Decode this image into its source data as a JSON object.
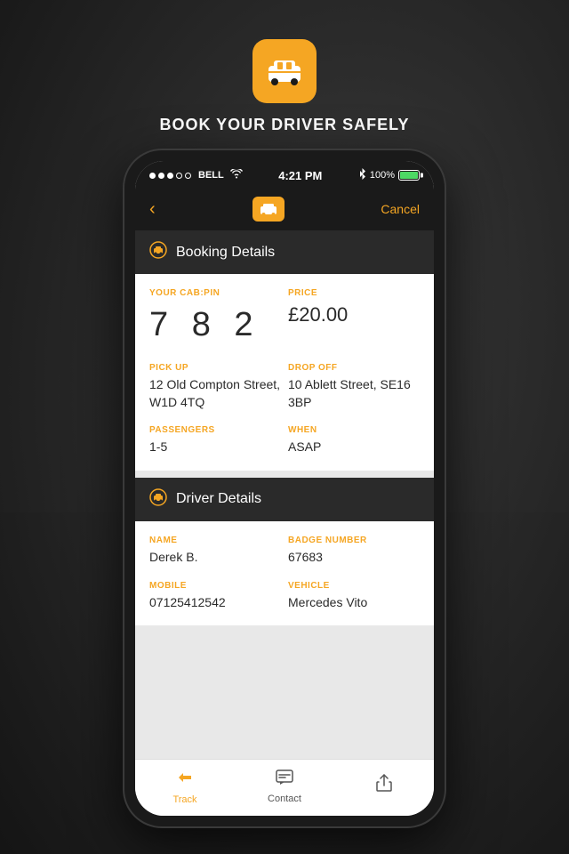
{
  "app": {
    "title": "BOOK YOUR DRIVER SAFELY",
    "logo_alt": "taxi-app-logo"
  },
  "status_bar": {
    "carrier": "BELL",
    "time": "4:21 PM",
    "battery_percent": "100%"
  },
  "nav": {
    "back_icon": "‹",
    "cancel_label": "Cancel"
  },
  "booking_section": {
    "title": "Booking Details",
    "icon": "🚕"
  },
  "booking": {
    "cab_pin_label": "YOUR CAB:PIN",
    "cab_pin": "7 8 2",
    "price_label": "PRICE",
    "price": "£20.00",
    "pickup_label": "PICK UP",
    "pickup": "12 Old Compton Street, W1D 4TQ",
    "dropoff_label": "DROP OFF",
    "dropoff": "10 Ablett Street, SE16 3BP",
    "passengers_label": "PASSENGERS",
    "passengers": "1-5",
    "when_label": "WHEN",
    "when": "ASAP"
  },
  "driver_section": {
    "title": "Driver Details",
    "icon": "🚕"
  },
  "driver": {
    "name_label": "NAME",
    "name": "Derek B.",
    "badge_label": "BADGE NUMBER",
    "badge": "67683",
    "mobile_label": "MOBILE",
    "mobile": "07125412542",
    "vehicle_label": "VEHICLE",
    "vehicle": "Mercedes Vito"
  },
  "tabs": [
    {
      "id": "track",
      "label": "Track",
      "icon": "track",
      "active": true
    },
    {
      "id": "contact",
      "label": "Contact",
      "icon": "contact",
      "active": false
    },
    {
      "id": "share",
      "label": "",
      "icon": "share",
      "active": false
    }
  ]
}
